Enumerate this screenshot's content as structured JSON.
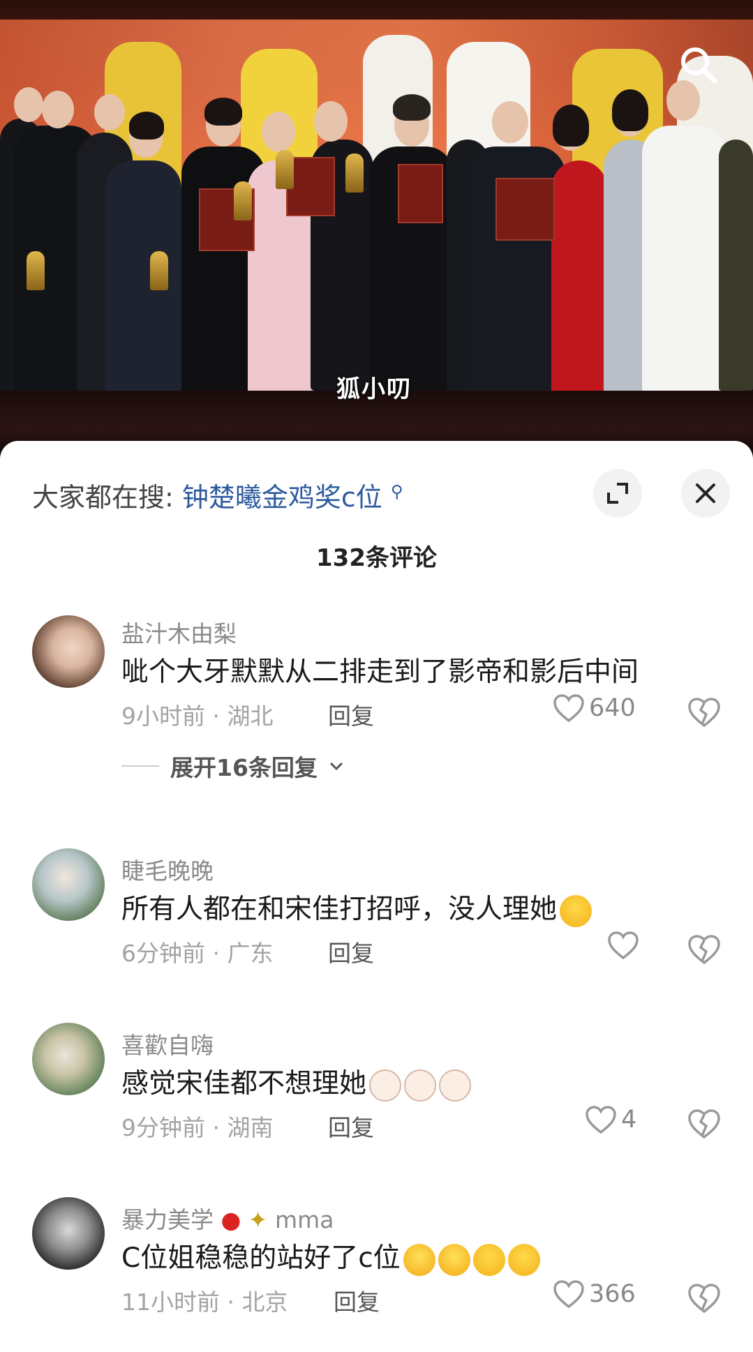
{
  "video": {
    "watermark": "狐小叨"
  },
  "sheet": {
    "hot_search_prefix": "大家都在搜:",
    "hot_search_keyword": "钟楚曦金鸡奖c位",
    "comment_count_title": "132条评论"
  },
  "comments": [
    {
      "username": "盐汁木由梨",
      "text": "呲个大牙默默从二排走到了影帝和影后中间",
      "meta": "9小时前 · 湖北",
      "reply_label": "回复",
      "likes": "640",
      "expand_label": "展开16条回复"
    },
    {
      "username": "睫毛晚晚",
      "text": "所有人都在和宋佳打招呼，没人理她",
      "meta": "6分钟前 · 广东",
      "reply_label": "回复",
      "likes": ""
    },
    {
      "username": "喜歡自嗨",
      "text": "感觉宋佳都不想理她",
      "meta": "9分钟前 · 湖南",
      "reply_label": "回复",
      "likes": "4"
    },
    {
      "username": "暴力美学",
      "username_suffix": "mma",
      "text": "C位姐稳稳的站好了c位",
      "meta": "11小时前 · 北京",
      "reply_label": "回复",
      "likes": "366"
    }
  ],
  "icons": {
    "video_search": "search-icon",
    "expand": "expand-icon",
    "close": "close-icon",
    "like": "heart-icon",
    "dislike": "broken-heart-icon",
    "chevron": "chevron-down-icon"
  },
  "colors": {
    "keyword_blue": "#2d5a9e",
    "sheet_bg": "#ffffff"
  }
}
